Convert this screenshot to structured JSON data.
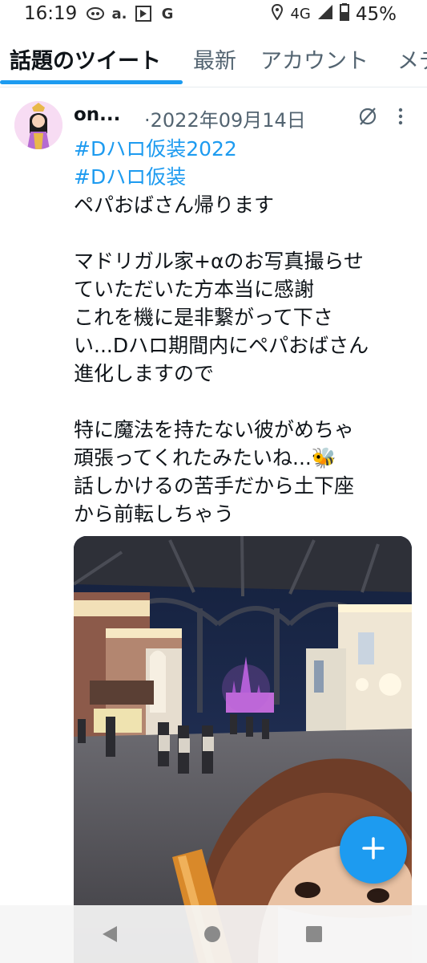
{
  "status_bar": {
    "time": "16:19",
    "network": "4G",
    "battery": "45%",
    "icons": [
      "notification-icon",
      "amazon-icon",
      "news-icon",
      "google-icon"
    ]
  },
  "tabs": [
    {
      "label": "話題のツイート",
      "active": true
    },
    {
      "label": "最新",
      "active": false
    },
    {
      "label": "アカウント",
      "active": false
    },
    {
      "label": "メディア",
      "active": false
    }
  ],
  "tweet": {
    "author": "on...",
    "date": "·2022年09月14日",
    "hashtags": [
      "#Dハロ仮装2022",
      "#Dハロ仮装"
    ],
    "lines": [
      "ペパおばさん帰ります",
      "",
      "マドリガル家+αのお写真撮らせ",
      "ていただいた方本当に感謝",
      "これを機に是非繋がって下さ",
      "い...Dハロ期間内にペパおばさん",
      "進化しますので",
      "",
      "特に魔法を持たない彼がめちゃ",
      "頑張ってくれたみたいね...🐝",
      "話しかけるの苦手だから土下座",
      "から前転しちゃう"
    ]
  },
  "fab": {
    "icon": "plus-icon"
  },
  "accent_color": "#1d9bf0"
}
